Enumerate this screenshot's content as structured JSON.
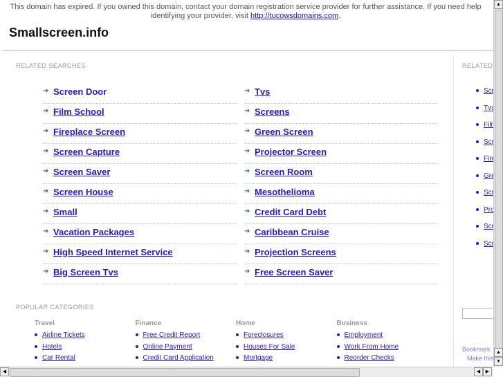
{
  "notice": {
    "text": "This domain has expired. If you owned this domain, contact your domain registration service provider for further assistance. If you need help identifying your provider, visit ",
    "link": "http://tucowsdomains.com",
    "after": "."
  },
  "site_title": "Smallscreen.info",
  "related": {
    "heading": "RELATED SEARCHES",
    "left": [
      "Screen Door",
      "Film School",
      "Fireplace Screen",
      "Screen Capture",
      "Screen Saver",
      "Screen House",
      "Small",
      "Vacation Packages",
      "High Speed Internet Service",
      "Big Screen Tvs"
    ],
    "right": [
      "Tvs",
      "Screens",
      "Green Screen",
      "Projector Screen",
      "Screen Room",
      "Mesothelioma",
      "Credit Card Debt",
      "Caribbean Cruise",
      "Projection Screens",
      "Free Screen Saver"
    ]
  },
  "popular": {
    "heading": "POPULAR CATEGORIES",
    "columns": [
      {
        "title": "Travel",
        "items": [
          "Airline Tickets",
          "Hotels",
          "Car Rental"
        ]
      },
      {
        "title": "Finance",
        "items": [
          "Free Credit Report",
          "Online Payment",
          "Credit Card Application"
        ]
      },
      {
        "title": "Home",
        "items": [
          "Foreclosures",
          "Houses For Sale",
          "Mortgage"
        ]
      },
      {
        "title": "Business",
        "items": [
          "Employment",
          "Work From Home",
          "Reorder Checks"
        ]
      }
    ]
  },
  "sidebar": {
    "heading": "RELATED",
    "items": [
      "Screen Door",
      "Tvs",
      "Film School",
      "Screens",
      "Fireplace Screen",
      "Green Screen",
      "Screen Capture",
      "Projector Screen",
      "Screen Saver",
      "Screen Room"
    ],
    "bookmark": "Bookmark",
    "make": "Make this"
  },
  "colors": {
    "link": "#2a17d0",
    "arrow": "#2f7a6f"
  }
}
